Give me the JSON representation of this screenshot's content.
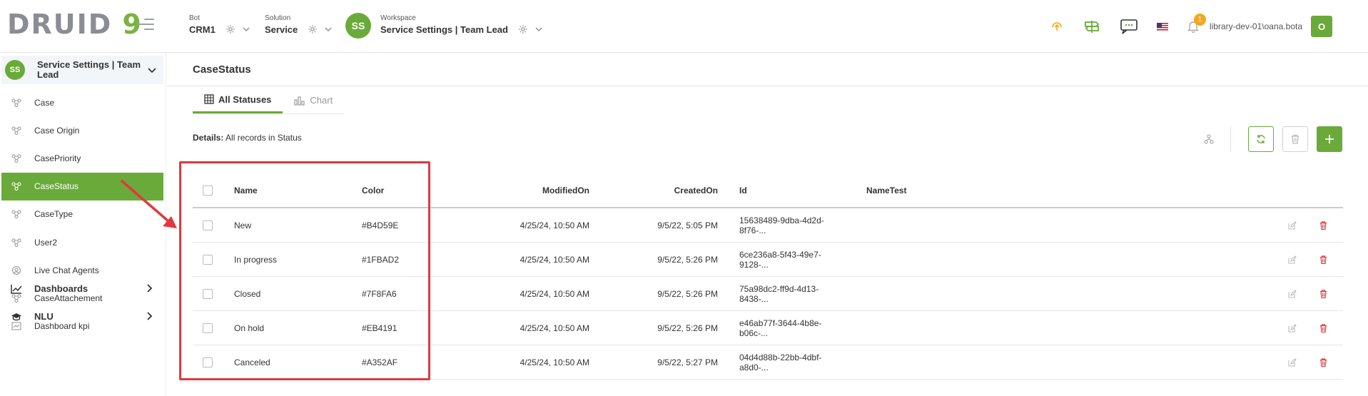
{
  "header": {
    "logo_text": "DRUID",
    "logo_number": "9",
    "bot": {
      "label": "Bot",
      "value": "CRM1"
    },
    "solution": {
      "label": "Solution",
      "value": "Service"
    },
    "workspace": {
      "label": "Workspace",
      "value": "Service Settings | Team Lead",
      "avatar": "SS"
    },
    "notification_count": "1",
    "user_name": "library-dev-01\\oana.bota",
    "user_initial": "O"
  },
  "sidebar": {
    "workspace_avatar": "SS",
    "workspace_name": "Service Settings | Team Lead",
    "items": [
      {
        "label": "Case",
        "icon": "entity-icon"
      },
      {
        "label": "Case Origin",
        "icon": "entity-icon"
      },
      {
        "label": "CasePriority",
        "icon": "entity-icon"
      },
      {
        "label": "CaseStatus",
        "icon": "entity-icon",
        "active": true
      },
      {
        "label": "CaseType",
        "icon": "entity-icon"
      },
      {
        "label": "User2",
        "icon": "entity-icon"
      },
      {
        "label": "Live Chat Agents",
        "icon": "agent-icon"
      },
      {
        "label": "CaseAttachement",
        "icon": "entity-icon"
      },
      {
        "label": "Dashboard kpi",
        "icon": "dashboard-icon"
      }
    ],
    "groups": [
      {
        "label": "Dashboards",
        "icon": "chart-line-icon"
      },
      {
        "label": "NLU",
        "icon": "graduation-cap-icon"
      }
    ]
  },
  "main": {
    "title": "CaseStatus",
    "tabs": [
      {
        "label": "All Statuses",
        "icon": "grid-icon",
        "active": true
      },
      {
        "label": "Chart",
        "icon": "bar-chart-icon",
        "active": false
      }
    ],
    "details_label": "Details:",
    "details_text": "All records in Status"
  },
  "table": {
    "columns": [
      "Name",
      "Color",
      "ModifiedOn",
      "CreatedOn",
      "Id",
      "NameTest"
    ],
    "rows": [
      {
        "name": "New",
        "color": "#B4D59E",
        "modified": "4/25/24, 10:50 AM",
        "created": "9/5/22, 5:05 PM",
        "id": "15638489-9dba-4d2d-8f76-...",
        "nametest": ""
      },
      {
        "name": "In progress",
        "color": "#1FBAD2",
        "modified": "4/25/24, 10:50 AM",
        "created": "9/5/22, 5:26 PM",
        "id": "6ce236a8-5f43-49e7-9128-...",
        "nametest": ""
      },
      {
        "name": "Closed",
        "color": "#7F8FA6",
        "modified": "4/25/24, 10:50 AM",
        "created": "9/5/22, 5:26 PM",
        "id": "75a98dc2-ff9d-4d13-8438-...",
        "nametest": ""
      },
      {
        "name": "On hold",
        "color": "#EB4191",
        "modified": "4/25/24, 10:50 AM",
        "created": "9/5/22, 5:26 PM",
        "id": "e46ab77f-3644-4b8e-b06c-...",
        "nametest": ""
      },
      {
        "name": "Canceled",
        "color": "#A352AF",
        "modified": "4/25/24, 10:50 AM",
        "created": "9/5/22, 5:27 PM",
        "id": "04d4d88b-22bb-4dbf-a8d0-...",
        "nametest": ""
      }
    ]
  },
  "colors": {
    "brand_green": "#6aaa3a",
    "annotation_red": "#e0393e",
    "delete_red": "#e0393e",
    "warning_orange": "#f5a623"
  }
}
